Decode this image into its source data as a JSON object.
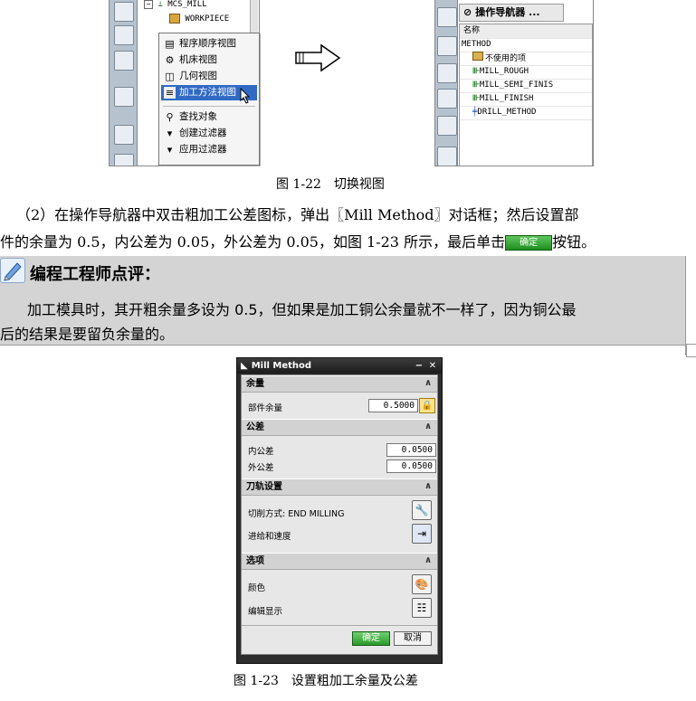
{
  "figure1": {
    "tree_root": "MCS_MILL",
    "tree_child": "WORKPIECE",
    "context_menu": [
      {
        "label": "程序顺序视图",
        "icon": "program-order-icon",
        "selected": false
      },
      {
        "label": "机床视图",
        "icon": "machine-tool-icon",
        "selected": false
      },
      {
        "label": "几何视图",
        "icon": "geometry-icon",
        "selected": false
      },
      {
        "label": "加工方法视图",
        "icon": "machining-method-icon",
        "selected": true
      },
      {
        "label": "查找对象",
        "icon": "find-object-icon",
        "selected": false
      },
      {
        "label": "创建过滤器",
        "icon": "create-filter-icon",
        "selected": false
      },
      {
        "label": "应用过滤器",
        "icon": "apply-filter-icon",
        "selected": false
      }
    ],
    "navigator_title": "操作导航器 ...",
    "navigator_header": "名称",
    "navigator_rows": [
      "METHOD",
      "不使用的项",
      "MILL_ROUGH",
      "MILL_SEMI_FINIS",
      "MILL_FINISH",
      "DRILL_METHOD"
    ],
    "caption": "图 1-22　切换视图"
  },
  "paragraph": {
    "line1": "（2）在操作导航器中双击粗加工公差图标，弹出〖Mill Method〗对话框；然后设置部",
    "line2_before": "件的余量为 0.5，内公差为 0.05，外公差为 0.05，如图 1-23 所示，最后单击",
    "ok_button": "确定",
    "line2_after": "按钮。"
  },
  "comment": {
    "title": "编程工程师点评：",
    "line1": "加工模具时，其开粗余量多设为 0.5，但如果是加工铜公余量就不一样了，因为铜公最",
    "line2": "后的结果是要留负余量的。"
  },
  "dialog": {
    "title": "Mill Method",
    "sections": {
      "stock": "余量",
      "tolerance": "公差",
      "tool_path": "刀轨设置",
      "options": "选项"
    },
    "part_stock_label": "部件余量",
    "part_stock_value": "0.5000",
    "intol_label": "内公差",
    "intol_value": "0.0500",
    "outtol_label": "外公差",
    "outtol_value": "0.0500",
    "cut_method_label": "切削方式: END MILLING",
    "feed_speed_label": "进给和速度",
    "color_label": "颜色",
    "edit_display_label": "编辑显示",
    "ok": "确定",
    "cancel": "取消",
    "caption": "图 1-23　设置粗加工余量及公差"
  }
}
